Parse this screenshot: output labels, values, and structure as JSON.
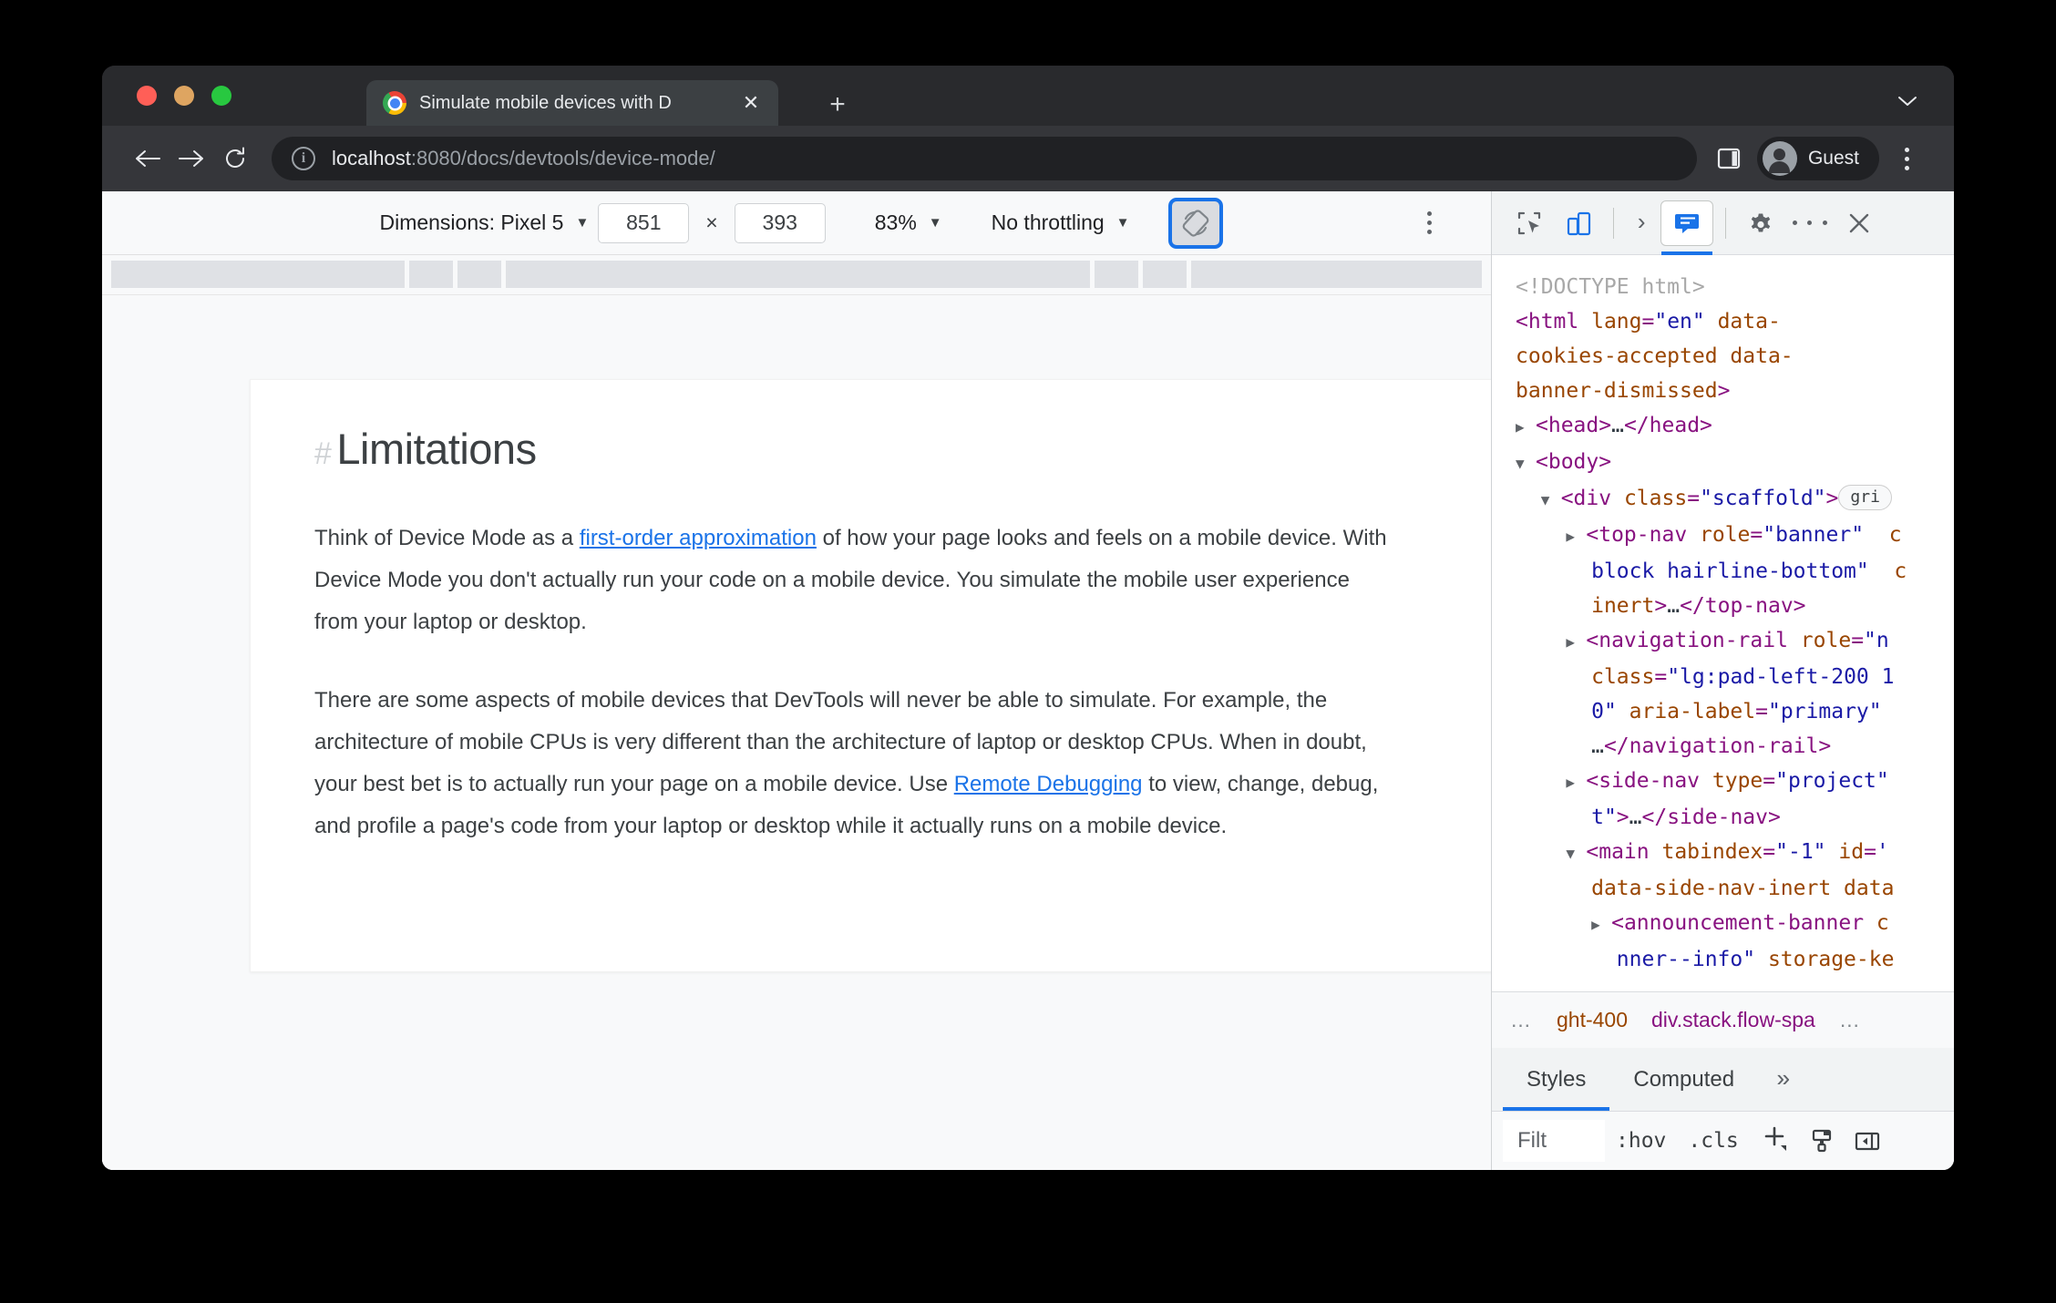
{
  "browser": {
    "tab": {
      "title": "Simulate mobile devices with D",
      "favicon": "chrome-logo-icon",
      "close_label": "✕"
    },
    "new_tab_label": "+",
    "window_chevron": "⌄",
    "omnibox": {
      "host": "localhost",
      "path": ":8080/docs/devtools/device-mode/",
      "info_icon": "i"
    },
    "profile": {
      "label": "Guest"
    }
  },
  "device_toolbar": {
    "dimensions_label": "Dimensions: Pixel 5",
    "width": "851",
    "height": "393",
    "times": "×",
    "zoom": "83%",
    "throttling": "No throttling",
    "rotate_icon": "rotate-device-icon",
    "caret": "▼"
  },
  "page": {
    "heading": "Limitations",
    "heading_hash": "#",
    "paragraphs": [
      {
        "before": "Think of Device Mode as a ",
        "link": "first-order approximation",
        "after": " of how your page looks and feels on a mobile device. With Device Mode you don't actually run your code on a mobile device. You simulate the mobile user experience from your laptop or desktop."
      },
      {
        "before": "There are some aspects of mobile devices that DevTools will never be able to simulate. For example, the architecture of mobile CPUs is very different than the architecture of laptop or desktop CPUs. When in doubt, your best bet is to actually run your page on a mobile device. Use ",
        "link": "Remote Debugging",
        "after": " to view, change, debug, and profile a page's code from your laptop or desktop while it actually runs on a mobile device."
      }
    ]
  },
  "devtools": {
    "toolbar": {
      "inspect_icon": "inspect-element-icon",
      "device_toggle_icon": "device-toolbar-icon",
      "overflow_chevron": "›",
      "active_panel_icon": "elements-panel-icon",
      "settings_icon": "gear-icon",
      "more_icon": "kebab-menu-icon",
      "close_icon": "✕"
    },
    "dom_lines": [
      [
        {
          "t": "doctype",
          "v": "<!DOCTYPE html>"
        }
      ],
      [
        {
          "t": "tag",
          "v": "<html "
        },
        {
          "t": "attr",
          "v": "lang"
        },
        {
          "t": "punc",
          "v": "="
        },
        {
          "t": "val",
          "v": "\"en\""
        },
        {
          "t": "attr",
          "v": " data-"
        }
      ],
      [
        {
          "t": "attr",
          "v": "cookies-accepted data-"
        }
      ],
      [
        {
          "t": "attr",
          "v": "banner-dismissed"
        },
        {
          "t": "tag",
          "v": ">"
        }
      ],
      [
        {
          "t": "arrow",
          "v": "▶"
        },
        {
          "t": "tag",
          "v": "<head>"
        },
        {
          "t": "ellipsis",
          "v": "…"
        },
        {
          "t": "tag",
          "v": "</head>"
        }
      ],
      [
        {
          "t": "arrowopen",
          "v": "▼"
        },
        {
          "t": "tag",
          "v": "<body>"
        }
      ],
      [
        {
          "t": "indent",
          "v": "  "
        },
        {
          "t": "arrowopen",
          "v": "▼"
        },
        {
          "t": "tag",
          "v": "<div "
        },
        {
          "t": "attr",
          "v": "class"
        },
        {
          "t": "punc",
          "v": "="
        },
        {
          "t": "val",
          "v": "\"scaffold\""
        },
        {
          "t": "tag",
          "v": ">"
        },
        {
          "t": "badge",
          "v": "gri"
        }
      ],
      [
        {
          "t": "indent",
          "v": "    "
        },
        {
          "t": "arrow",
          "v": "▶"
        },
        {
          "t": "tag",
          "v": "<top-nav "
        },
        {
          "t": "attr",
          "v": "role"
        },
        {
          "t": "punc",
          "v": "="
        },
        {
          "t": "val",
          "v": "\"banner\""
        },
        {
          "t": "attr",
          "v": "  c"
        }
      ],
      [
        {
          "t": "indent",
          "v": "      "
        },
        {
          "t": "val",
          "v": "block hairline-bottom\""
        },
        {
          "t": "attr",
          "v": "  c"
        }
      ],
      [
        {
          "t": "indent",
          "v": "      "
        },
        {
          "t": "attr",
          "v": "inert"
        },
        {
          "t": "tag",
          "v": ">"
        },
        {
          "t": "ellipsis",
          "v": "…"
        },
        {
          "t": "tag",
          "v": "</top-nav>"
        }
      ],
      [
        {
          "t": "indent",
          "v": "    "
        },
        {
          "t": "arrow",
          "v": "▶"
        },
        {
          "t": "tag",
          "v": "<navigation-rail "
        },
        {
          "t": "attr",
          "v": "role"
        },
        {
          "t": "punc",
          "v": "="
        },
        {
          "t": "val",
          "v": "\"n"
        }
      ],
      [
        {
          "t": "indent",
          "v": "      "
        },
        {
          "t": "attr",
          "v": "class"
        },
        {
          "t": "punc",
          "v": "="
        },
        {
          "t": "val",
          "v": "\"lg:pad-left-200 1"
        }
      ],
      [
        {
          "t": "indent",
          "v": "      "
        },
        {
          "t": "val",
          "v": "0\""
        },
        {
          "t": "attr",
          "v": " aria-label"
        },
        {
          "t": "punc",
          "v": "="
        },
        {
          "t": "val",
          "v": "\"primary\""
        }
      ],
      [
        {
          "t": "indent",
          "v": "      "
        },
        {
          "t": "ellipsis",
          "v": "…"
        },
        {
          "t": "tag",
          "v": "</navigation-rail>"
        }
      ],
      [
        {
          "t": "indent",
          "v": "    "
        },
        {
          "t": "arrow",
          "v": "▶"
        },
        {
          "t": "tag",
          "v": "<side-nav "
        },
        {
          "t": "attr",
          "v": "type"
        },
        {
          "t": "punc",
          "v": "="
        },
        {
          "t": "val",
          "v": "\"project\""
        }
      ],
      [
        {
          "t": "indent",
          "v": "      "
        },
        {
          "t": "val",
          "v": "t\""
        },
        {
          "t": "tag",
          "v": ">"
        },
        {
          "t": "ellipsis",
          "v": "…"
        },
        {
          "t": "tag",
          "v": "</side-nav>"
        }
      ],
      [
        {
          "t": "indent",
          "v": "    "
        },
        {
          "t": "arrowopen",
          "v": "▼"
        },
        {
          "t": "tag",
          "v": "<main "
        },
        {
          "t": "attr",
          "v": "tabindex"
        },
        {
          "t": "punc",
          "v": "="
        },
        {
          "t": "val",
          "v": "\"-1\""
        },
        {
          "t": "attr",
          "v": " id"
        },
        {
          "t": "punc",
          "v": "="
        },
        {
          "t": "val",
          "v": "'"
        }
      ],
      [
        {
          "t": "indent",
          "v": "      "
        },
        {
          "t": "attr",
          "v": "data-side-nav-inert data"
        }
      ],
      [
        {
          "t": "indent",
          "v": "      "
        },
        {
          "t": "arrow",
          "v": "▶"
        },
        {
          "t": "tag",
          "v": "<announcement-banner "
        },
        {
          "t": "attr",
          "v": "c"
        }
      ],
      [
        {
          "t": "indent",
          "v": "        "
        },
        {
          "t": "val",
          "v": "nner--info\""
        },
        {
          "t": "attr",
          "v": " storage-ke"
        }
      ]
    ],
    "breadcrumb": {
      "left_dots": "…",
      "items": [
        "ght-400",
        "div.stack.flow-spa"
      ],
      "right_dots": "…"
    },
    "subtabs": [
      {
        "label": "Styles",
        "active": true
      },
      {
        "label": "Computed",
        "active": false
      }
    ],
    "subtab_overflow": "»",
    "styles_toolbar": {
      "filter_value": "Filt",
      "hov": ":hov",
      "cls": ".cls",
      "add_rule_icon": "plus-icon",
      "color_picker_icon": "paint-brush-icon",
      "sidebar_toggle_icon": "toggle-sidebar-icon"
    }
  }
}
